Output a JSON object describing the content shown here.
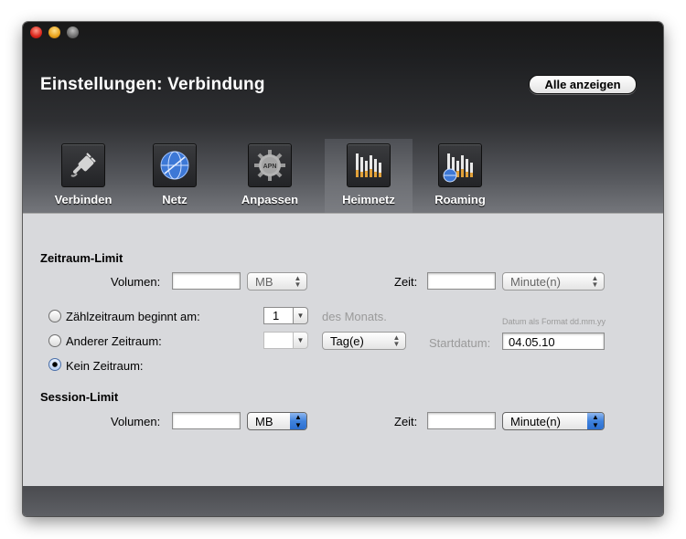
{
  "window": {
    "title": "Einstellungen: Verbindung",
    "show_all_button": "Alle anzeigen"
  },
  "tabs": [
    {
      "label": "Verbinden",
      "icon": "plug-icon"
    },
    {
      "label": "Netz",
      "icon": "globe-icon"
    },
    {
      "label": "Anpassen",
      "icon": "apn-gear-icon",
      "icon_text": "APN"
    },
    {
      "label": "Heimnetz",
      "icon": "signal-bars-icon",
      "active": true
    },
    {
      "label": "Roaming",
      "icon": "signal-bars-globe-icon"
    }
  ],
  "period_limit": {
    "heading": "Zeitraum-Limit",
    "volume_label": "Volumen:",
    "volume_value": "",
    "volume_unit": "MB",
    "time_label": "Zeit:",
    "time_value": "",
    "time_unit": "Minute(n)",
    "radio_counting_start": "Zählzeitraum beginnt am:",
    "day_value": "1",
    "month_suffix": "des Monats.",
    "date_format_hint": "Datum als Format dd.mm.yy",
    "radio_other_period": "Anderer Zeitraum:",
    "other_period_value": "",
    "other_period_unit": "Tag(e)",
    "start_date_label": "Startdatum:",
    "start_date_value": "04.05.10",
    "radio_no_period": "Kein Zeitraum:",
    "selected_radio": "Kein Zeitraum:"
  },
  "session_limit": {
    "heading": "Session-Limit",
    "volume_label": "Volumen:",
    "volume_value": "",
    "volume_unit": "MB",
    "time_label": "Zeit:",
    "time_value": "",
    "time_unit": "Minute(n)"
  },
  "colors": {
    "accent": "#3f82dd",
    "header_dark": "#1e1f21",
    "content_bg": "#d8d9dc"
  }
}
